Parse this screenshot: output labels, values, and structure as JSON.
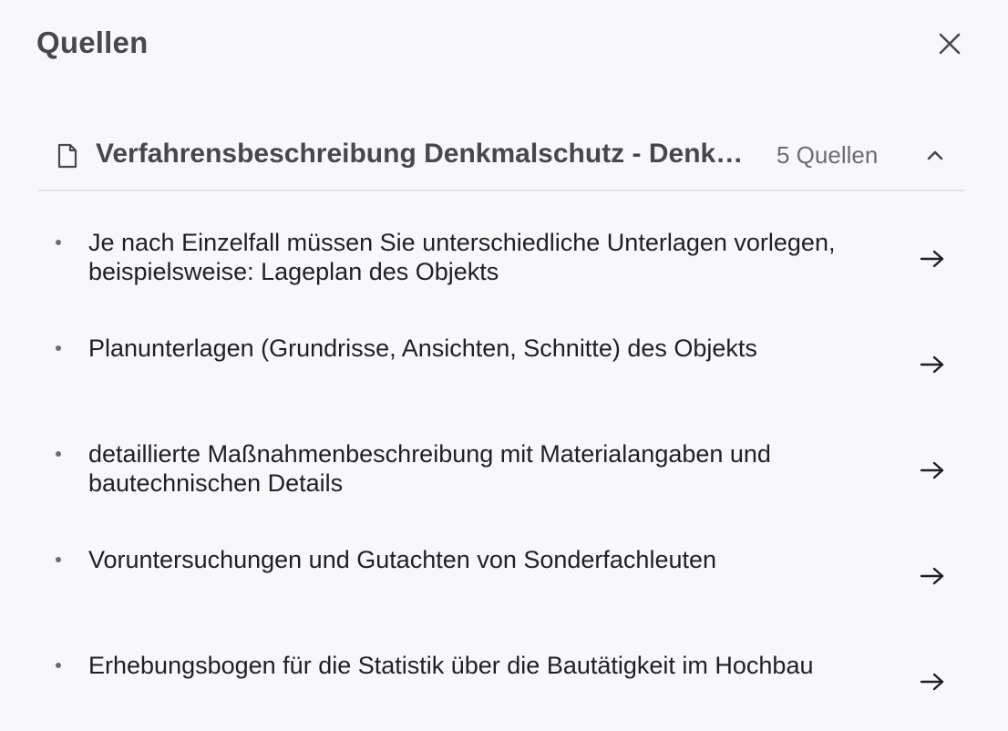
{
  "panel": {
    "title": "Quellen",
    "close_label": "close"
  },
  "group": {
    "title": "Verfahrensbeschreibung Denkmalschutz - Denkmalrechtliche Erlaubnis",
    "count": "5 Quellen",
    "expanded": true,
    "icon": "document-icon"
  },
  "sources": [
    {
      "text": "Je nach Einzelfall müssen Sie unterschiedliche Unterlagen vorlegen, beispielsweise: Lageplan des Objekts"
    },
    {
      "text": "Planunterlagen (Grundrisse, Ansichten, Schnitte) des Objekts"
    },
    {
      "text": "detaillierte Maßnahmenbeschreibung mit Materialangaben und bautechnischen Details"
    },
    {
      "text": "Voruntersuchungen und Gutachten von Sonderfachleuten"
    },
    {
      "text": "Erhebungsbogen für die Statistik über die Bautätigkeit im Hochbau"
    }
  ],
  "colors": {
    "background": "#f8f8fb",
    "heading": "#47474f",
    "body_text": "#1f1f24",
    "muted": "#6b6b73",
    "divider": "#e5e5ea"
  }
}
